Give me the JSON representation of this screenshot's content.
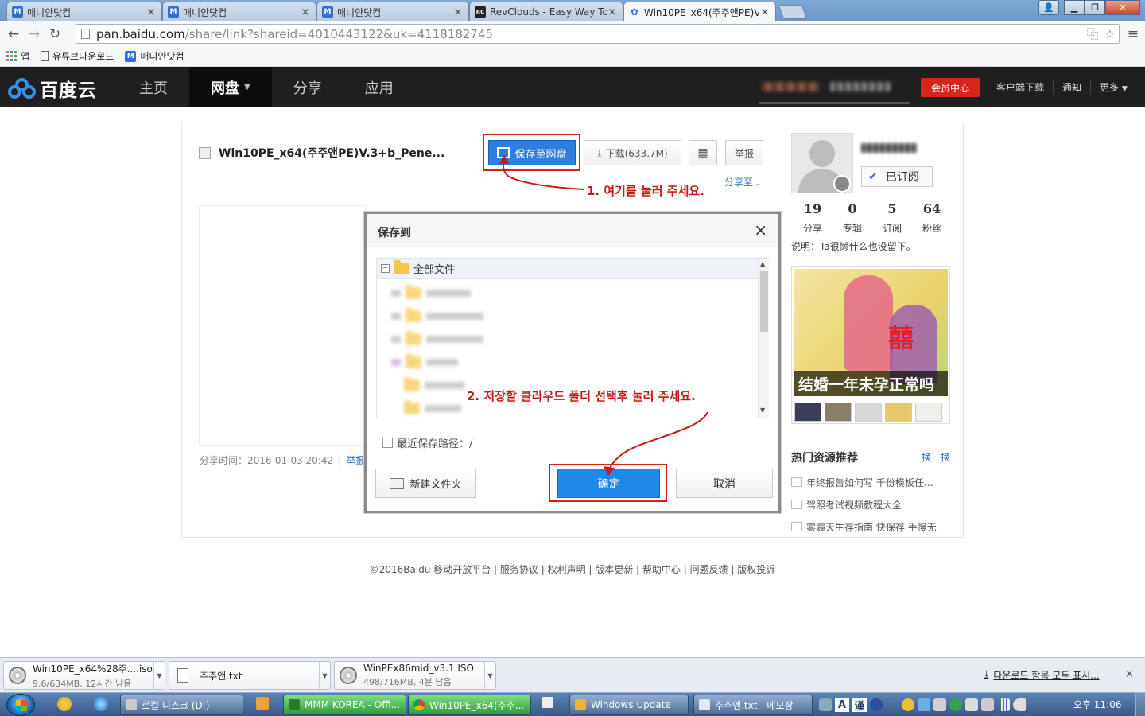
{
  "browser": {
    "tabs": [
      {
        "label": "매니안닷컴",
        "favicon": "m-icon",
        "active": false
      },
      {
        "label": "매니안닷컴",
        "favicon": "m-icon",
        "active": false
      },
      {
        "label": "매니안닷컴",
        "favicon": "m-icon",
        "active": false
      },
      {
        "label": "RevClouds - Easy Way To",
        "favicon": "rc-icon",
        "active": false
      },
      {
        "label": "Win10PE_x64(주주앤PE)V.",
        "favicon": "baidu-cloud-icon",
        "active": true
      }
    ],
    "tab_close": "×",
    "url_main": "pan.baidu.com",
    "url_rest": "/share/link?shareid=4010443122&uk=4118182745",
    "bookmarks": [
      {
        "label": "앱",
        "icon": "apps-icon"
      },
      {
        "label": "유튜브다운로드",
        "icon": "page-icon"
      },
      {
        "label": "매니안닷컴",
        "icon": "m-icon"
      }
    ]
  },
  "baidu": {
    "logo_text": "百度云",
    "nav": [
      {
        "label": "主页"
      },
      {
        "label": "网盘",
        "active": true
      },
      {
        "label": "分享"
      },
      {
        "label": "应用"
      }
    ],
    "vip_label": "会员中心",
    "header_links": [
      "客户端下载",
      "通知",
      "更多"
    ],
    "brand_color": "#2e7fdc"
  },
  "share": {
    "file_name": "Win10PE_x64(주주앤PE)V.3+b_Pene...",
    "save_label": "保存至网盘",
    "download_label": "下载(633.7M)",
    "report_label": "举报",
    "share_to": "分享至",
    "share_time": "分享时间：2016-01-03 20:42",
    "report_link": "举报",
    "annotation_1": "1. 여기를 눌러 주세요."
  },
  "profile": {
    "subscribed_label": "已订阅",
    "stats": [
      {
        "num": "19",
        "label": "分享"
      },
      {
        "num": "0",
        "label": "专辑"
      },
      {
        "num": "5",
        "label": "订阅"
      },
      {
        "num": "64",
        "label": "粉丝"
      }
    ],
    "description": "说明：Ta很懒什么也没留下。",
    "ad_caption": "结婚一年未孕正常吗",
    "ad_glyph": "囍",
    "hot_title": "热门资源推荐",
    "hot_change": "换一换",
    "hot_items": [
      "年终报告如何写 千份模板任…",
      "驾照考试视频教程大全",
      "雾霾天生存指南 快保存 手慢无"
    ]
  },
  "footer": "©2016Baidu 移动开放平台 | 服务协议 | 权利声明 | 版本更新 | 帮助中心 | 问题反馈 | 版权投诉",
  "dialog": {
    "title": "保存到",
    "close": "×",
    "root_folder": "全部文件",
    "recent_label": "最近保存路径：/",
    "new_folder": "新建文件夹",
    "ok": "确定",
    "cancel": "取消",
    "annotation_2": "2. 저장할 클라우드 폴더 선택후 눌러 주세요."
  },
  "downloads": {
    "items": [
      {
        "name": "Win10PE_x64%28주....iso",
        "status": "9.6/634MB, 12시간 남음",
        "icon": "disc-icon"
      },
      {
        "name": "주주앤.txt",
        "status": "",
        "icon": "text-file-icon"
      },
      {
        "name": "WinPEx86mid_v3.1.ISO",
        "status": "498/716MB, 4분 남음",
        "icon": "disc-icon"
      }
    ],
    "show_all": "다운로드 항목 모두 표시...",
    "close": "×"
  },
  "taskbar": {
    "items": [
      {
        "label": "로컬 디스크 (D:)"
      },
      {
        "label": "MMM KOREA - Offi..."
      },
      {
        "label": "Win10PE_x64(주주..."
      },
      {
        "label": "Windows Update"
      },
      {
        "label": "주주앤.txt - 메모장"
      }
    ],
    "lang_a": "A",
    "lang_han": "漢",
    "clock": "오후 11:06"
  },
  "annotation_color": "#c41c15"
}
